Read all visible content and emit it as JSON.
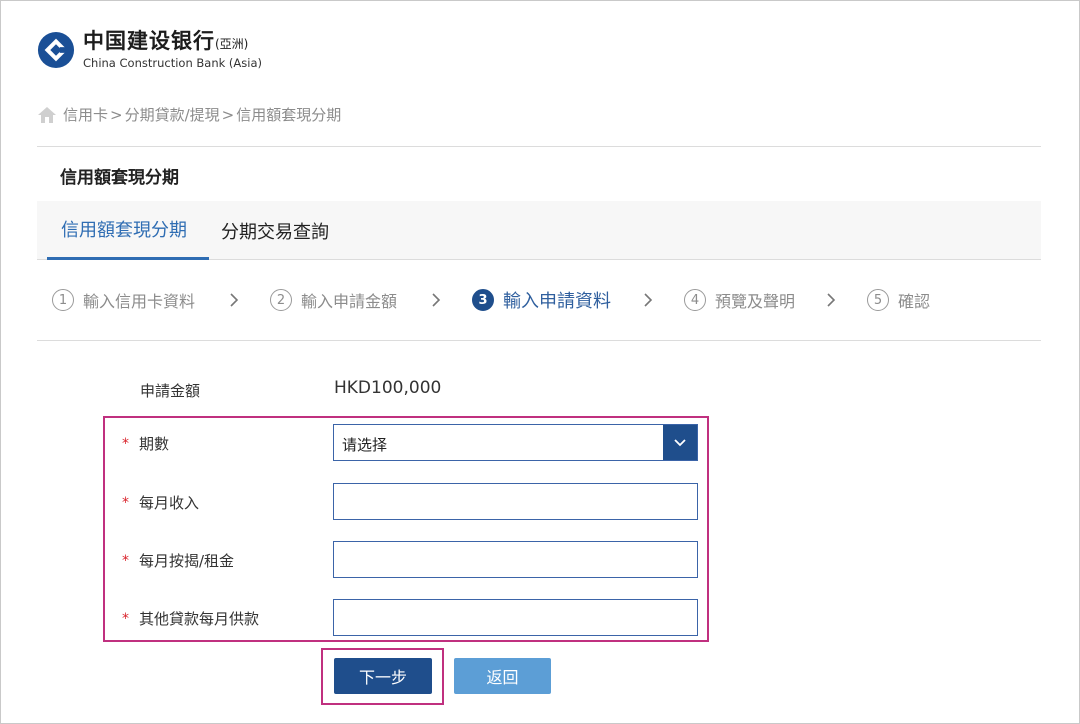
{
  "logo": {
    "cn": "中国建设银行",
    "cn_sub": "(亞洲)",
    "en": "China Construction Bank (Asia)"
  },
  "breadcrumb": {
    "items": [
      "信用卡",
      "分期貸款/提現",
      "信用額套現分期"
    ],
    "separator": ">"
  },
  "section_title": "信用額套現分期",
  "tabs": [
    {
      "label": "信用額套現分期",
      "active": true
    },
    {
      "label": "分期交易查詢",
      "active": false
    }
  ],
  "steps": [
    {
      "num": "1",
      "label": "輸入信用卡資料",
      "active": false
    },
    {
      "num": "2",
      "label": "輸入申請金額",
      "active": false
    },
    {
      "num": "3",
      "label": "輸入申請資料",
      "active": true
    },
    {
      "num": "4",
      "label": "預覽及聲明",
      "active": false
    },
    {
      "num": "5",
      "label": "確認",
      "active": false
    }
  ],
  "form": {
    "amount_label": "申請金額",
    "amount_value": "HKD100,000",
    "required_mark": "*",
    "installments": {
      "label": "期數",
      "selected": "请选择"
    },
    "monthly_income": {
      "label": "每月收入",
      "value": ""
    },
    "mortgage_rent": {
      "label": "每月按揭/租金",
      "value": ""
    },
    "other_loans": {
      "label": "其他貸款每月供款",
      "value": ""
    }
  },
  "buttons": {
    "next": "下一步",
    "back": "返回"
  },
  "colors": {
    "primary": "#1f4e8c",
    "tab_active": "#2f6db3",
    "back_button": "#5c9ed6",
    "highlight": "#c0307f",
    "required": "#d9232b"
  }
}
